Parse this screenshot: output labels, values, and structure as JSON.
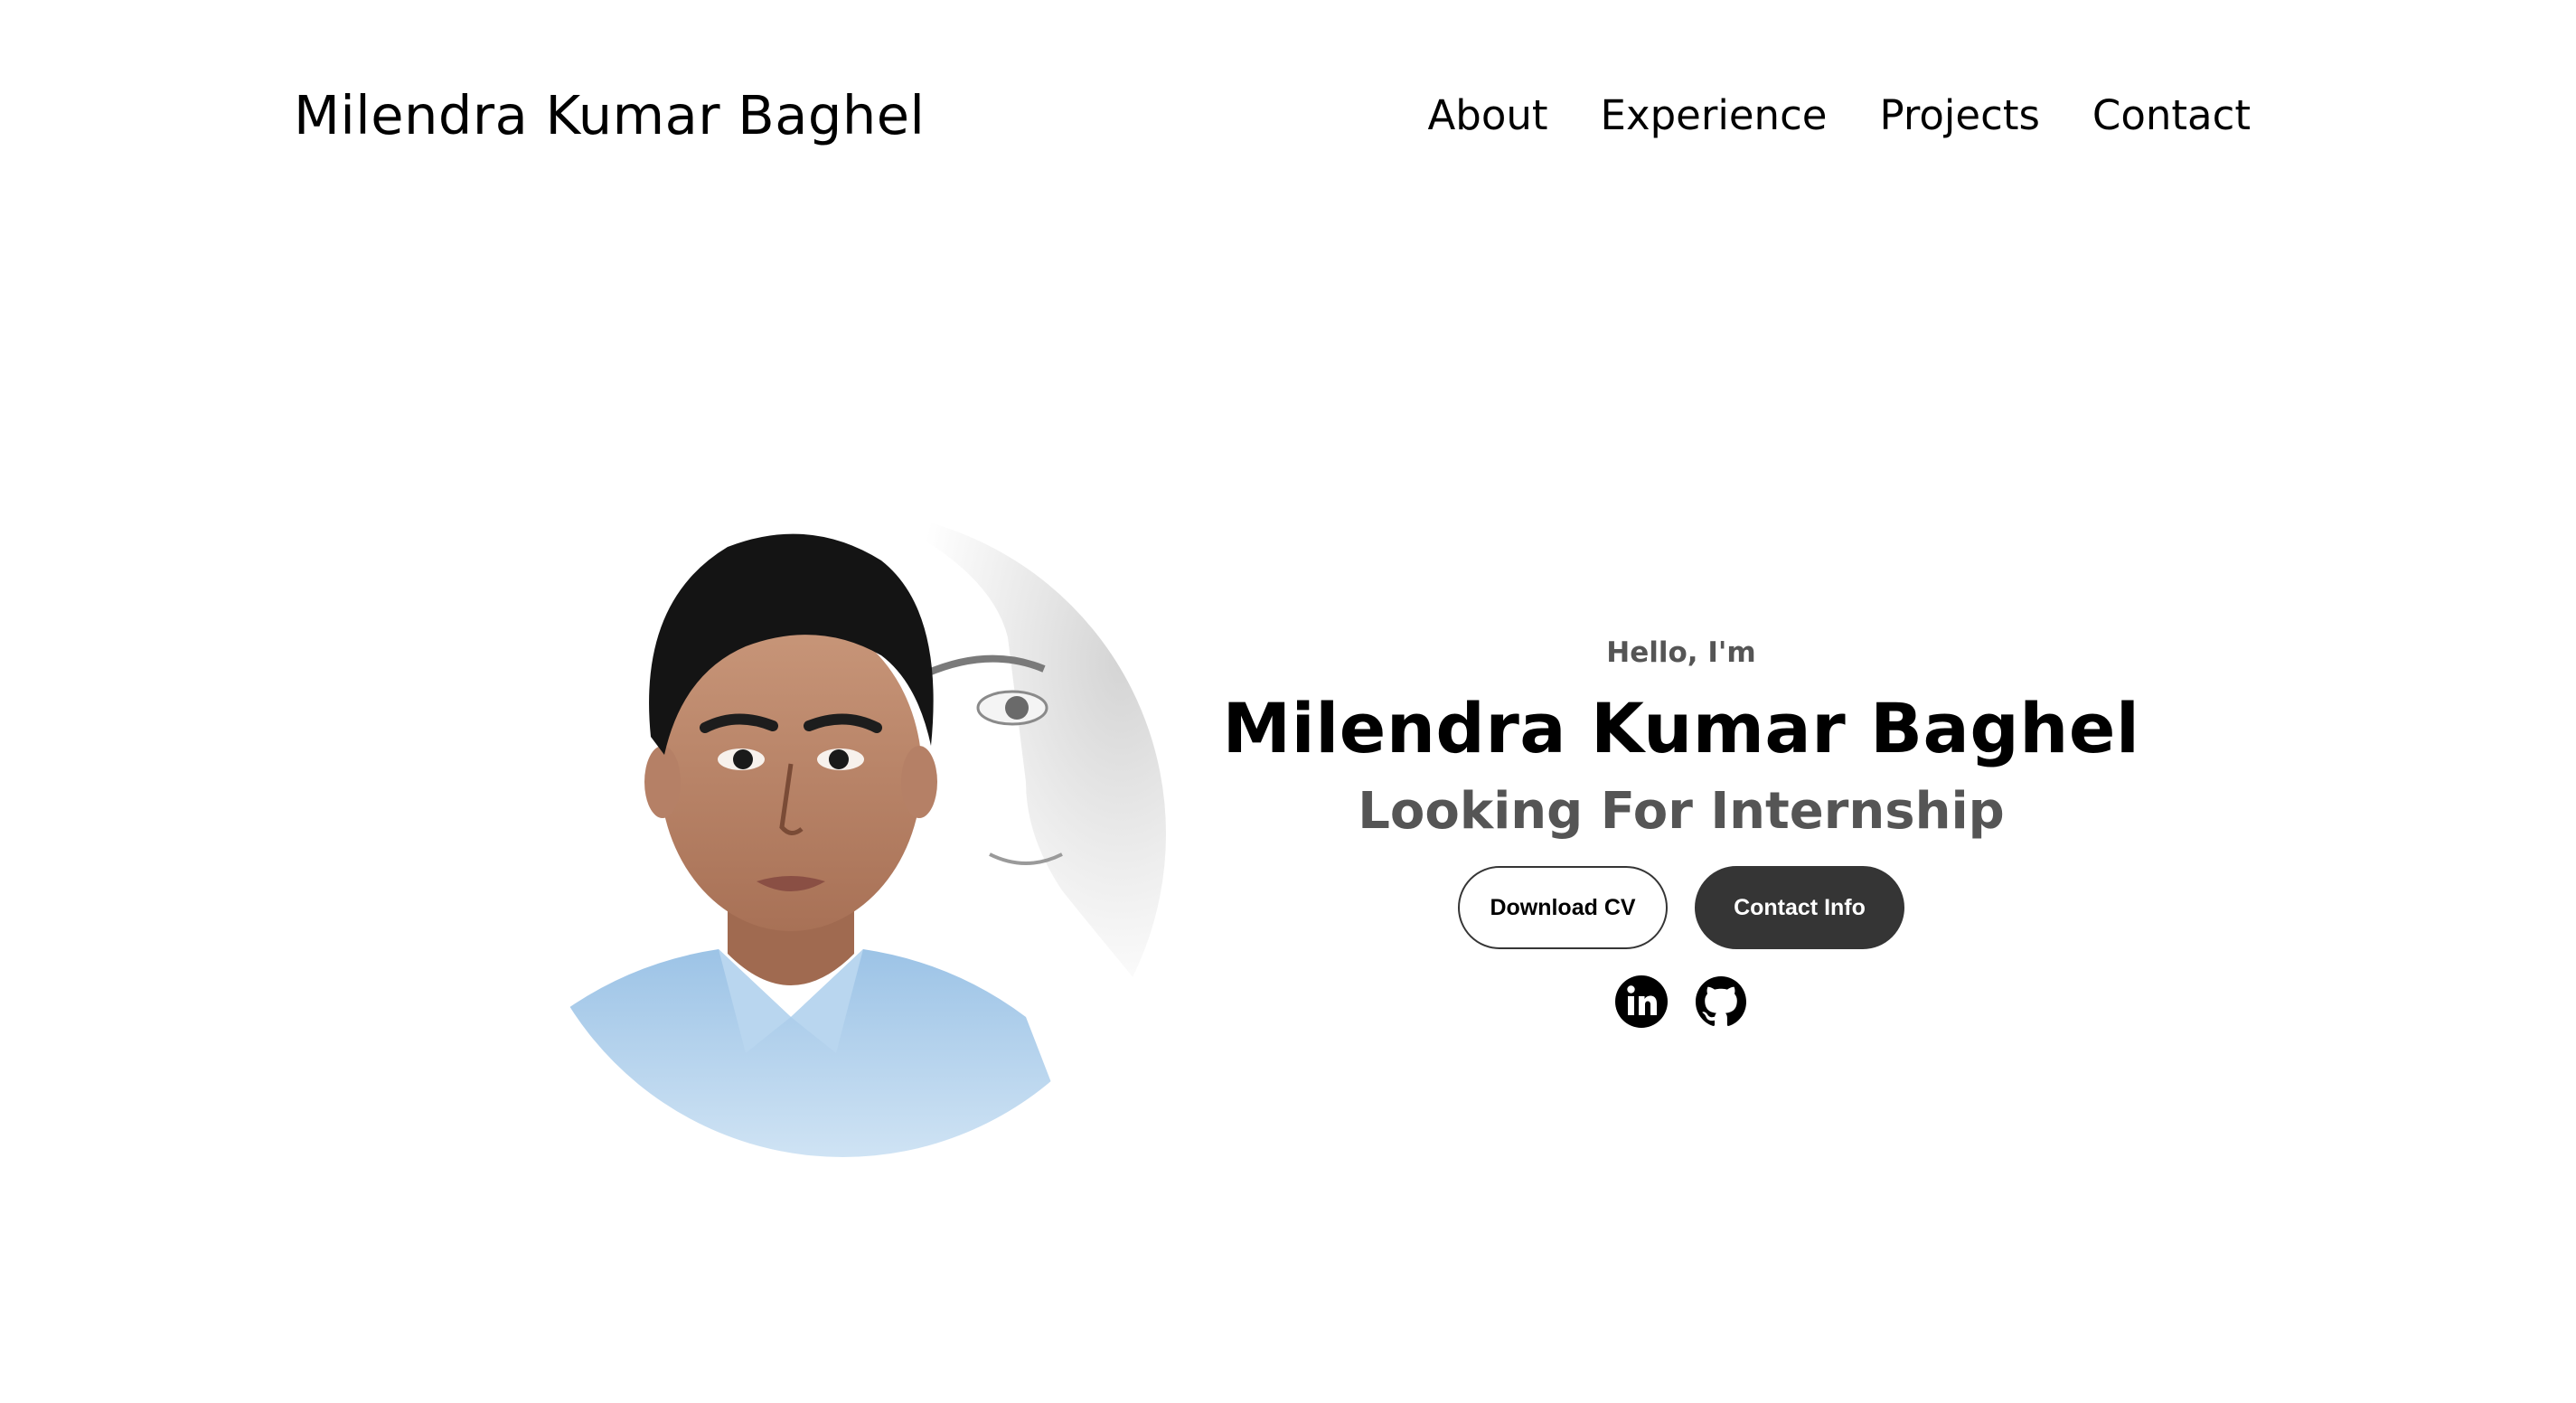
{
  "nav": {
    "logo": "Milendra Kumar Baghel",
    "links": [
      {
        "label": "About"
      },
      {
        "label": "Experience"
      },
      {
        "label": "Projects"
      },
      {
        "label": "Contact"
      }
    ]
  },
  "profile": {
    "greeting": "Hello, I'm",
    "name": "Milendra Kumar Baghel",
    "subtitle": "Looking For Internship",
    "buttons": {
      "download_cv": "Download CV",
      "contact_info": "Contact Info"
    },
    "socials": [
      {
        "icon": "linkedin-icon"
      },
      {
        "icon": "github-icon"
      }
    ]
  },
  "colors": {
    "text_primary": "#000000",
    "text_secondary": "#555555",
    "button_dark": "#353535",
    "background": "#ffffff"
  }
}
